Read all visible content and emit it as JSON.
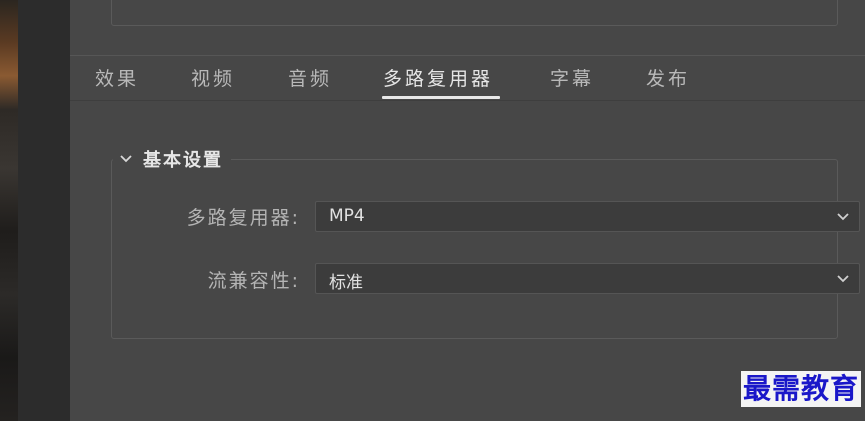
{
  "tabs": [
    {
      "label": "效果",
      "active": false
    },
    {
      "label": "视频",
      "active": false
    },
    {
      "label": "音频",
      "active": false
    },
    {
      "label": "多路复用器",
      "active": true
    },
    {
      "label": "字幕",
      "active": false
    },
    {
      "label": "发布",
      "active": false
    }
  ],
  "basic_settings": {
    "title": "基本设置",
    "expanded": true,
    "fields": [
      {
        "label": "多路复用器:",
        "value": "MP4"
      },
      {
        "label": "流兼容性:",
        "value": "标准"
      }
    ]
  },
  "watermark": "最需教育",
  "colors": {
    "panel_bg": "#474747",
    "select_bg": "#3c3c3c",
    "accent_underline": "#e8e8e8",
    "watermark": "#1a17c9"
  }
}
